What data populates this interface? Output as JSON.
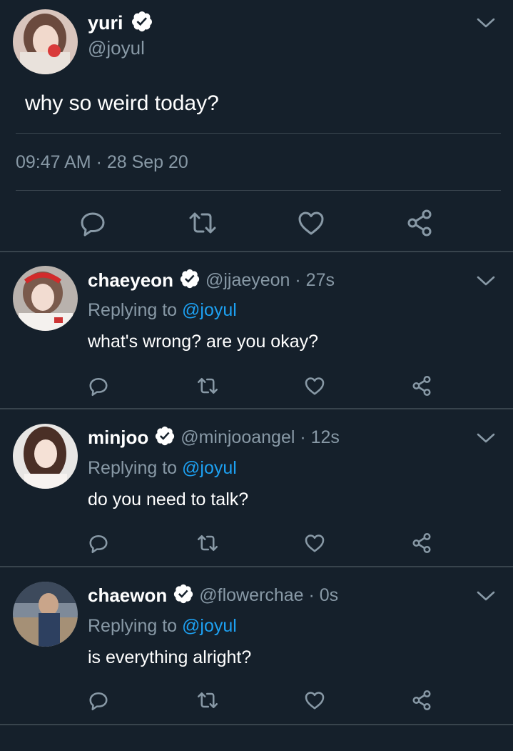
{
  "colors": {
    "background": "#15202b",
    "text": "#ffffff",
    "muted": "#8899a6",
    "link": "#1da1f2",
    "divider": "#38444d"
  },
  "main_tweet": {
    "name": "yuri",
    "handle": "@joyul",
    "text": "why so weird today?",
    "timestamp": "09:47 AM · 28 Sep 20",
    "icons": [
      "reply-icon",
      "retweet-icon",
      "like-icon",
      "share-icon"
    ]
  },
  "replies": [
    {
      "name": "chaeyeon",
      "meta": "@jjaeyeon · 27s",
      "replying_prefix": "Replying to ",
      "replying_handle": "@joyul",
      "text": "what's wrong? are you okay?"
    },
    {
      "name": "minjoo",
      "meta": "@minjooangel · 12s",
      "replying_prefix": "Replying to ",
      "replying_handle": "@joyul",
      "text": "do you need to talk?"
    },
    {
      "name": "chaewon",
      "meta": "@flowerchae · 0s",
      "replying_prefix": "Replying to ",
      "replying_handle": "@joyul",
      "text": "is everything alright?"
    }
  ]
}
